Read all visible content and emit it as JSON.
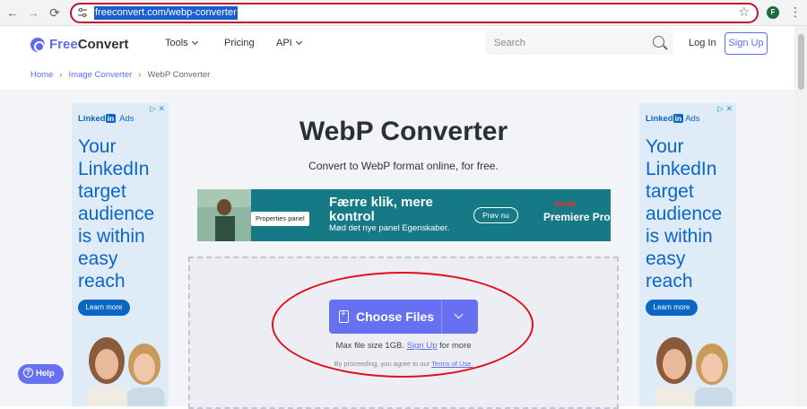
{
  "browser": {
    "url": "freeconvert.com/webp-converter",
    "back_icon": "←",
    "forward_icon": "→",
    "reload_icon": "⟳",
    "star_icon": "☆",
    "avatar_letter": "F",
    "menu_icon": "⋮"
  },
  "header": {
    "logo_free": "Free",
    "logo_convert": "Convert",
    "nav": {
      "tools": "Tools",
      "pricing": "Pricing",
      "api": "API"
    },
    "search_placeholder": "Search",
    "login": "Log In",
    "signup": "Sign Up"
  },
  "breadcrumb": {
    "home": "Home",
    "image_converter": "Image Converter",
    "current": "WebP Converter"
  },
  "ads": {
    "brand": "Linked",
    "brand_in": "in",
    "brand_ads": "Ads",
    "close": "▷ ✕",
    "headline": "Your LinkedIn target audience is within easy reach",
    "cta": "Learn more"
  },
  "main": {
    "title": "WebP Converter",
    "subtitle": "Convert to WebP format online, for free."
  },
  "banner": {
    "properties_panel": "Properties panel",
    "headline": "Færre klik, mere kontrol",
    "subline": "Mød det nye panel Egenskaber.",
    "cta": "Prøv nu",
    "adobe": "Adobe",
    "product": "Premiere Pro"
  },
  "upload": {
    "choose_files": "Choose Files",
    "max_prefix": "Max file size 1GB.",
    "signup_link": "Sign Up",
    "max_suffix": "for more",
    "terms_prefix": "By proceeding, you agree to our",
    "terms_link": "Terms of Use."
  },
  "help": {
    "label": "Help"
  },
  "colors": {
    "accent": "#6670f0",
    "annotation": "#e0101c",
    "linkedin": "#0a66c2"
  }
}
